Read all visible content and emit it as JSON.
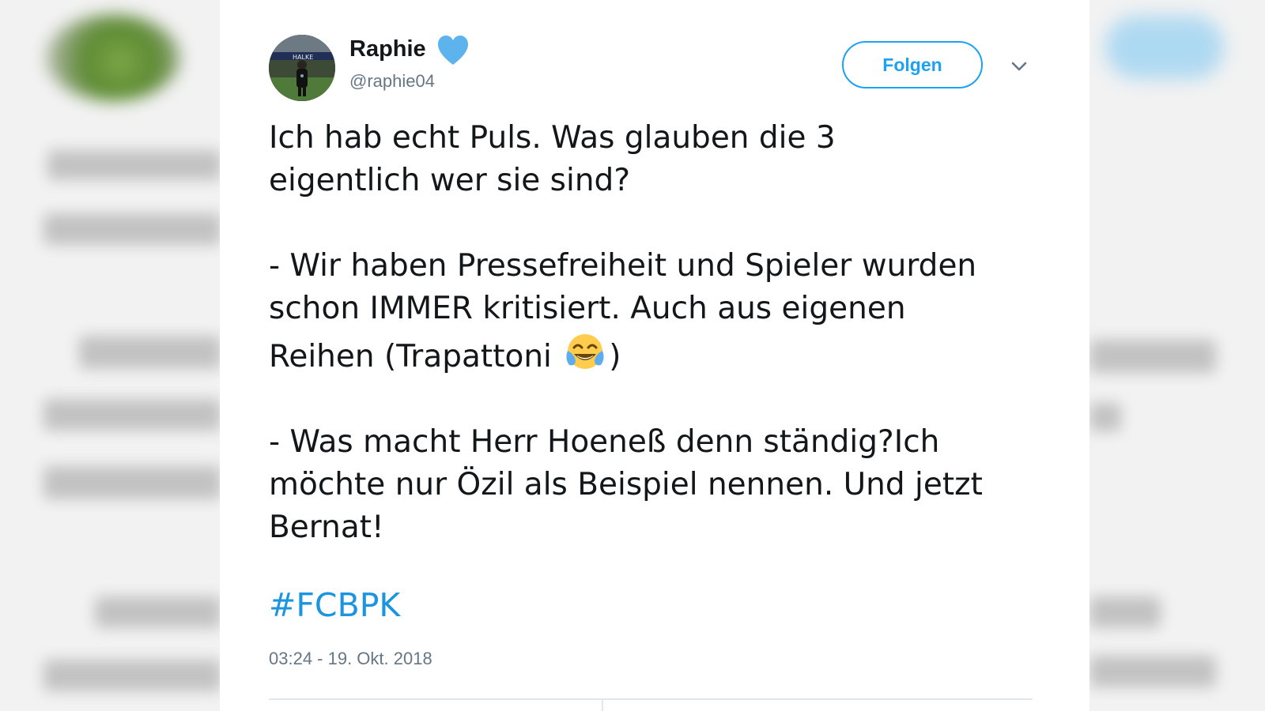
{
  "tweet": {
    "display_name": "Raphie",
    "handle": "@raphie04",
    "follow_label": "Folgen",
    "text": {
      "line1a": "Ich hab echt Puls. Was glauben die 3",
      "line1b": "eigentlich wer sie sind?",
      "line2a": "- Wir haben Pressefreiheit und Spieler wurden",
      "line2b": "schon IMMER kritisiert. Auch aus eigenen",
      "line2c_before": "Reihen (Trapattoni ",
      "line2c_after": ")",
      "line3a": "- Was macht Herr Hoeneß denn ständig?Ich",
      "line3b": "möchte nur Özil als Beispiel nennen. Und jetzt",
      "line3c": "Bernat!"
    },
    "emoji": "face-with-tears-of-joy",
    "hashtag": "#FCBPK",
    "timestamp": "03:24 - 19. Okt. 2018"
  },
  "icons": {
    "verified_heart": "blue-heart-icon",
    "menu": "chevron-down-icon"
  },
  "colors": {
    "accent": "#1da1f2",
    "hashtag": "#1b95e0",
    "heart": "#5db3ec",
    "text": "#14171a",
    "muted": "#657786",
    "divider": "#e1e8ed"
  }
}
